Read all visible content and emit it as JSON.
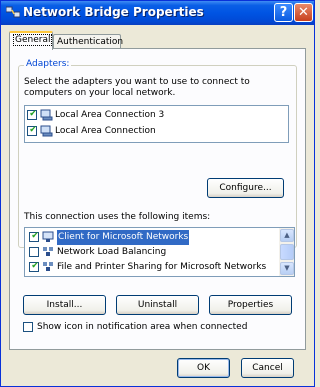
{
  "window": {
    "title": "Network Bridge Properties",
    "help_glyph": "?",
    "close_glyph": "✕"
  },
  "tabs": [
    {
      "label": "General",
      "active": true
    },
    {
      "label": "Authentication",
      "active": false
    }
  ],
  "adapters": {
    "legend": "Adapters:",
    "description": "Select the adapters you want to use to connect to computers on your local network.",
    "items": [
      {
        "label": "Local Area Connection 3",
        "checked": true
      },
      {
        "label": "Local Area Connection",
        "checked": true
      }
    ],
    "configure_label": "Configure..."
  },
  "items": {
    "heading": "This connection uses the following items:",
    "list": [
      {
        "label": "Client for Microsoft Networks",
        "checked": true,
        "selected": true
      },
      {
        "label": "Network Load Balancing",
        "checked": false,
        "selected": false
      },
      {
        "label": "File and Printer Sharing for Microsoft Networks",
        "checked": true,
        "selected": false
      }
    ]
  },
  "buttons": {
    "install": "Install...",
    "uninstall": "Uninstall",
    "properties": "Properties"
  },
  "show_icon": {
    "label": "Show icon in notification area when connected",
    "checked": false
  },
  "footer": {
    "ok": "OK",
    "cancel": "Cancel"
  },
  "colors": {
    "titlebar": "#0054E3",
    "selection": "#316AC5",
    "legend": "#0046D5"
  },
  "icons": {
    "adapter": "network-adapter-icon",
    "client": "network-client-icon",
    "service": "network-service-icon"
  }
}
